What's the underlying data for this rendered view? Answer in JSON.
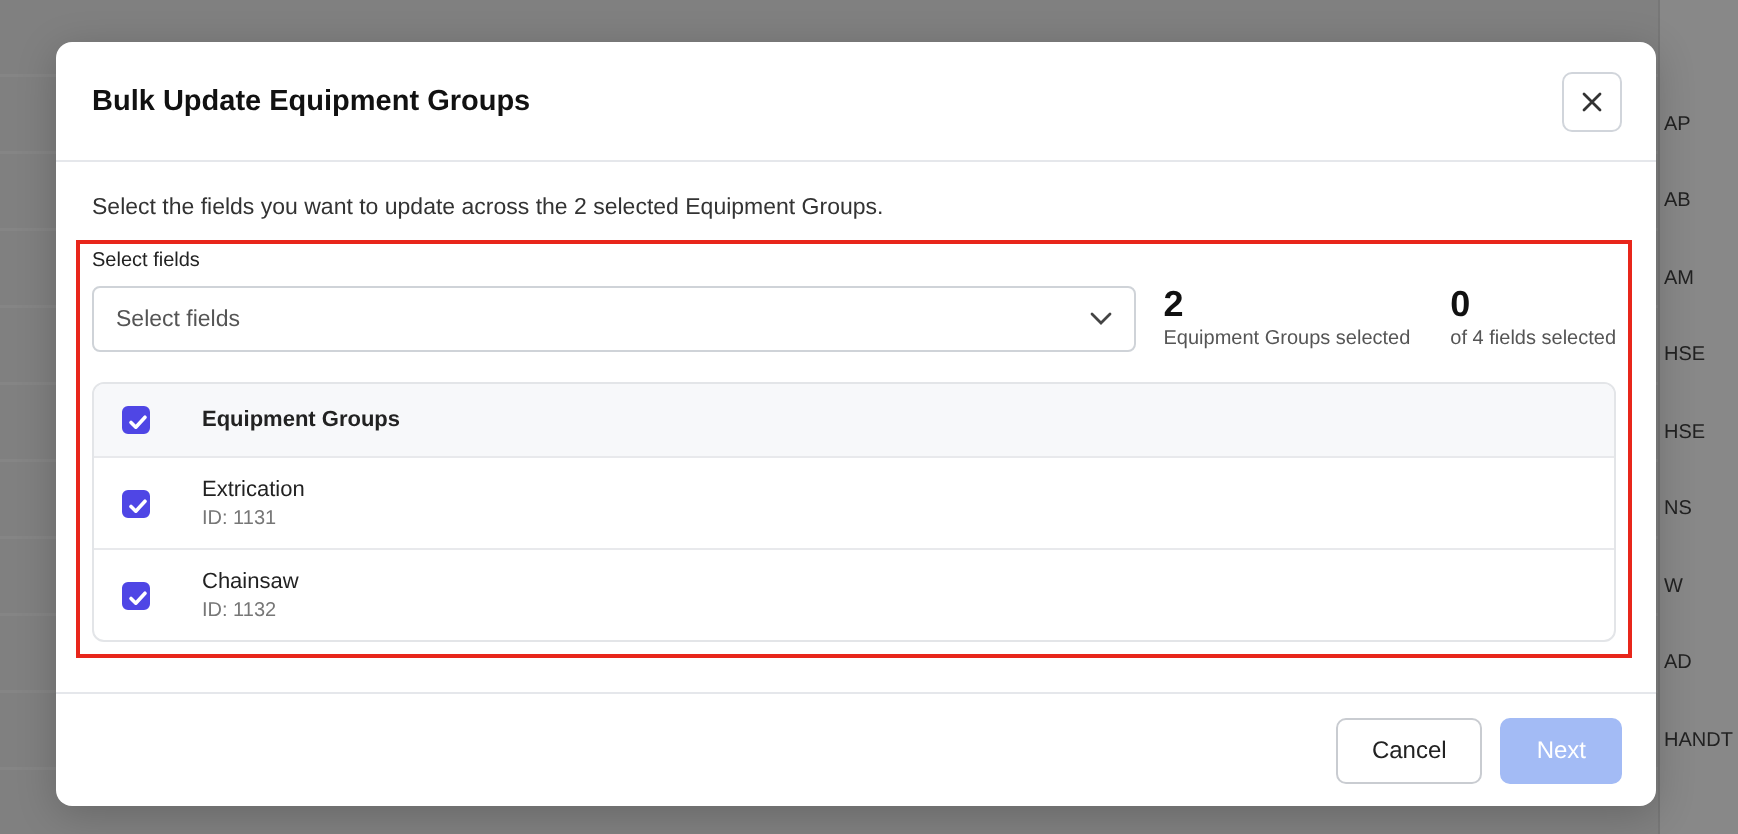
{
  "background": {
    "column_cells": [
      "AP",
      "AB",
      "AM",
      "HSE",
      "HSE",
      "NS",
      "W",
      "AD",
      "HANDT"
    ]
  },
  "dialog": {
    "title": "Bulk Update Equipment Groups",
    "description": "Select the fields you want to update across the 2 selected Equipment Groups.",
    "field_label": "Select fields",
    "select": {
      "placeholder": "Select fields"
    },
    "stats": [
      {
        "value": "2",
        "label": "Equipment Groups selected"
      },
      {
        "value": "0",
        "label": "of 4 fields selected"
      }
    ],
    "table": {
      "header": {
        "label": "Equipment Groups",
        "checked": true
      },
      "rows": [
        {
          "name": "Extrication",
          "id": "ID: 1131",
          "checked": true
        },
        {
          "name": "Chainsaw",
          "id": "ID: 1132",
          "checked": true
        }
      ]
    },
    "buttons": [
      {
        "label": "Cancel",
        "kind": "secondary",
        "disabled": false
      },
      {
        "label": "Next",
        "kind": "primary",
        "disabled": true
      }
    ]
  }
}
